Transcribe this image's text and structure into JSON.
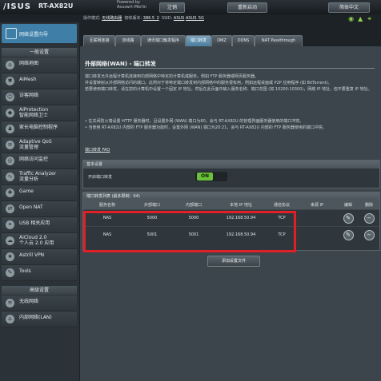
{
  "header": {
    "logo": "/ISUS",
    "model": "RT-AX82U",
    "powered_by": "Powered by",
    "firmware_brand": "Asuswrt-Merlin",
    "buttons": [
      "注销",
      "重新启动",
      "简体中文"
    ]
  },
  "status": {
    "mode_label": "操作模式:",
    "mode_value": "无线路由器",
    "fw_label": "韧体版本:",
    "fw_value": "386.5_2",
    "ssid_label": "SSID:",
    "ssid_values": [
      "ASUS",
      "ASUS_5G"
    ]
  },
  "sidebar": {
    "quick_setup": "网络设置向导",
    "general_header": "一般设置",
    "general_items": [
      {
        "label": "网络地图",
        "icon": "map-icon"
      },
      {
        "label": "AiMesh",
        "icon": "mesh-icon"
      },
      {
        "label": "访客网络",
        "icon": "guest-icon"
      },
      {
        "label": "AiProtection\n智能网络卫士",
        "icon": "shield-icon"
      },
      {
        "label": "家长电脑控制程序",
        "icon": "parental-icon"
      },
      {
        "label": "Adaptive QoS\n流量管理",
        "icon": "qos-icon"
      },
      {
        "label": "网络访问监控",
        "icon": "monitor-icon"
      },
      {
        "label": "Traffic Analyzer\n流量分析",
        "icon": "analyzer-icon"
      },
      {
        "label": "Game",
        "icon": "game-icon"
      },
      {
        "label": "Open NAT",
        "icon": "nat-icon"
      },
      {
        "label": "USB 相关应用",
        "icon": "usb-icon"
      },
      {
        "label": "AiCloud 2.0\n个人云 2.0 应用",
        "icon": "cloud-icon"
      },
      {
        "label": "Astrill VPN",
        "icon": "vpn-icon"
      },
      {
        "label": "Tools",
        "icon": "tools-icon"
      }
    ],
    "advanced_header": "高级设置",
    "advanced_items": [
      {
        "label": "无线网络",
        "icon": "wifi-icon"
      },
      {
        "label": "内部网络(LAN)",
        "icon": "lan-icon"
      }
    ]
  },
  "tabs": [
    "互联网连接",
    "双线路",
    "通讯端口触发程序",
    "端口转发",
    "DMZ",
    "DDNS",
    "NAT Passthrough"
  ],
  "active_tab": 3,
  "page": {
    "title": "外部网络(WAN) - 端口转发",
    "intro": [
      "端口转发允许远程计算机连接到内部网络中特定的计算机或服务。例如 FTP 服务器或网页服务器。",
      "并设置映射从外部网络访问的端口。此例对于将特定端口转发到内部网络中的服务很有用，例如远程桌面或 P2P 应用程序 (如 BitTorrent)。",
      "若要使用端口转发，请在您的计算机中设置一个固定 IP 地址，然后在此页面中输入服务名称、端口范围 (如 10200:10300)，网络 IP 地址，但不要重复 IP 地址。"
    ],
    "bullets": [
      "• 在关闭防火墙设置 HTTP 服务器时，且设置外网 (WAN) 端口为80，会与 RT-AX82U 的管理界面服务器使用的端口冲突。",
      "• 当使用 RT-AX82U 内部的 FTP 服务器功能时，设置外网 (WAN) 端口为20:21，会与 RT-AX82U 内部的 FTP 服务器使用的端口冲突。"
    ],
    "faq": "端口转发 FAQ"
  },
  "basic": {
    "header": "基本设置",
    "toggle_label": "开启端口转发",
    "toggle_value": "ON"
  },
  "list": {
    "header": "端口转发列表 (最多限制：64)",
    "columns": [
      "服务名称",
      "外部端口",
      "内部端口",
      "本地 IP 地址",
      "通信协议",
      "来源 IP",
      "编辑",
      "删除"
    ],
    "rows": [
      {
        "name": "NAS",
        "ext": "5000",
        "int": "5000",
        "ip": "192.168.50.94",
        "proto": "TCP",
        "src": ""
      },
      {
        "name": "NAS",
        "ext": "5001",
        "int": "5001",
        "ip": "192.168.50.94",
        "proto": "TCP",
        "src": ""
      }
    ],
    "add_button": "添加设置文件"
  },
  "colors": {
    "accent": "#3f7fa7",
    "toggle_on": "#6cc13b",
    "highlight_box": "#e01f26"
  }
}
